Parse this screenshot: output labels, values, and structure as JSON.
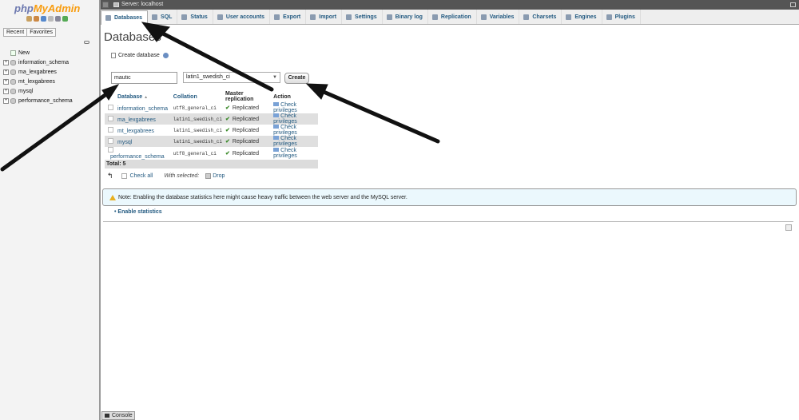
{
  "app": {
    "logo_part1": "php",
    "logo_part2": "MyAdmin"
  },
  "sidebar": {
    "tabs": [
      "Recent",
      "Favorites"
    ],
    "tree": [
      {
        "label": "New",
        "icon": "new-icon"
      },
      {
        "label": "information_schema"
      },
      {
        "label": "ma_lexgabrees"
      },
      {
        "label": "mt_lexgabrees"
      },
      {
        "label": "mysql"
      },
      {
        "label": "performance_schema"
      }
    ]
  },
  "topbar": {
    "server": "Server: localhost"
  },
  "nav": {
    "tabs": [
      {
        "label": "Databases",
        "icon": "database-icon",
        "active": true
      },
      {
        "label": "SQL",
        "icon": "sql-icon"
      },
      {
        "label": "Status",
        "icon": "status-icon"
      },
      {
        "label": "User accounts",
        "icon": "users-icon"
      },
      {
        "label": "Export",
        "icon": "export-icon"
      },
      {
        "label": "Import",
        "icon": "import-icon"
      },
      {
        "label": "Settings",
        "icon": "settings-icon"
      },
      {
        "label": "Binary log",
        "icon": "binlog-icon"
      },
      {
        "label": "Replication",
        "icon": "replication-icon"
      },
      {
        "label": "Variables",
        "icon": "variables-icon"
      },
      {
        "label": "Charsets",
        "icon": "charsets-icon"
      },
      {
        "label": "Engines",
        "icon": "engines-icon"
      },
      {
        "label": "Plugins",
        "icon": "plugins-icon"
      }
    ]
  },
  "main": {
    "title": "Databases",
    "create": {
      "header": "Create database",
      "name_value": "mautic",
      "collation_value": "latin1_swedish_ci",
      "button": "Create"
    },
    "table": {
      "headers": {
        "database": "Database",
        "sort": "▲",
        "collation": "Collation",
        "replication": "Master replication",
        "action": "Action"
      },
      "rows": [
        {
          "name": "information_schema",
          "collation": "utf8_general_ci",
          "replication": "Replicated",
          "action": "Check privileges"
        },
        {
          "name": "ma_lexgabrees",
          "collation": "latin1_swedish_ci",
          "replication": "Replicated",
          "action": "Check privileges"
        },
        {
          "name": "mt_lexgabrees",
          "collation": "latin1_swedish_ci",
          "replication": "Replicated",
          "action": "Check privileges"
        },
        {
          "name": "mysql",
          "collation": "latin1_swedish_ci",
          "replication": "Replicated",
          "action": "Check privileges"
        },
        {
          "name": "performance_schema",
          "collation": "utf8_general_ci",
          "replication": "Replicated",
          "action": "Check privileges"
        }
      ],
      "total": "Total: 5"
    },
    "bulk": {
      "check_all": "Check all",
      "with_selected": "With selected:",
      "drop": "Drop"
    },
    "notice": "Note: Enabling the database statistics here might cause heavy traffic between the web server and the MySQL server.",
    "enable_stats": "Enable statistics"
  },
  "console": {
    "label": "Console"
  },
  "colors": {
    "link": "#235a81",
    "notice_bg": "#ebf8fd",
    "topbar": "#555555"
  }
}
